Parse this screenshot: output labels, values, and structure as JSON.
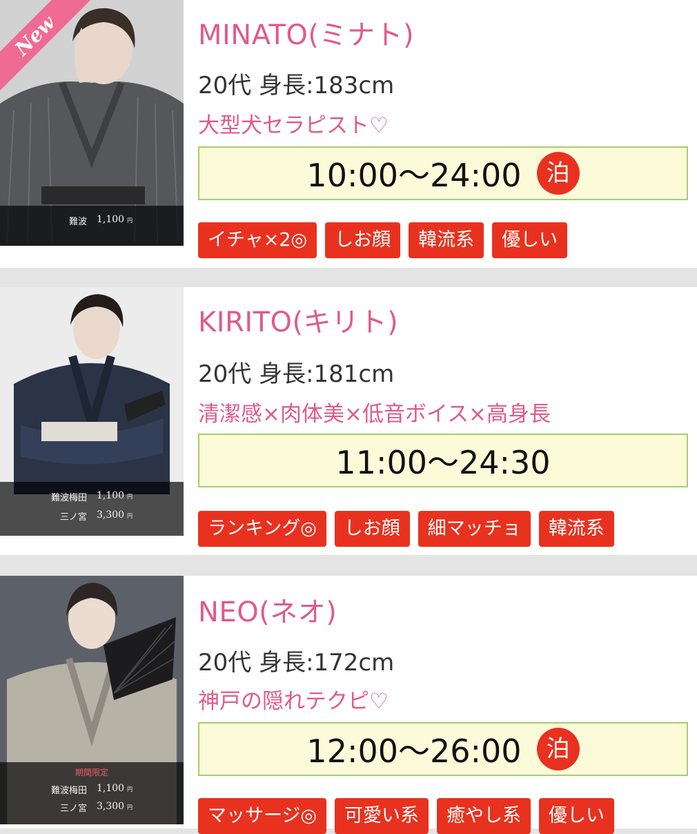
{
  "cards": [
    {
      "name": "MINATO(ミナト)",
      "spec": "20代 身長:183cm",
      "catch": "大型犬セラピスト♡",
      "hours": "10:00〜24:00",
      "stay_badge": "泊",
      "new_badge": "New",
      "prices": [
        {
          "area": "難波",
          "amount": "1,100",
          "unit": "円"
        }
      ],
      "tags": [
        "イチャ×2◎",
        "しお顔",
        "韓流系",
        "優しい"
      ]
    },
    {
      "name": "KIRITO(キリト)",
      "spec": "20代 身長:181cm",
      "catch": "清潔感×肉体美×低音ボイス×高身長",
      "hours": "11:00〜24:30",
      "prices": [
        {
          "area": "難波梅田",
          "amount": "1,100",
          "unit": "円"
        },
        {
          "area": "三ノ宮",
          "amount": "3,300",
          "unit": "円"
        }
      ],
      "tags": [
        "ランキング◎",
        "しお顔",
        "細マッチョ",
        "韓流系"
      ]
    },
    {
      "name": "NEO(ネオ)",
      "spec": "20代 身長:172cm",
      "catch": "神戸の隠れテクピ♡",
      "hours": "12:00〜26:00",
      "stay_badge": "泊",
      "limited_label": "期間限定",
      "prices": [
        {
          "area": "難波梅田",
          "amount": "1,100",
          "unit": "円"
        },
        {
          "area": "三ノ宮",
          "amount": "3,300",
          "unit": "円"
        }
      ],
      "tags": [
        "マッサージ◎",
        "可愛い系",
        "癒やし系",
        "優しい"
      ]
    }
  ],
  "colors": {
    "name_pink": "#e05a8c",
    "tag_red": "#e8321f",
    "hours_bg": "#fcfbd9",
    "hours_border": "#a5cf6a",
    "new_ribbon": "#ef6b94"
  }
}
